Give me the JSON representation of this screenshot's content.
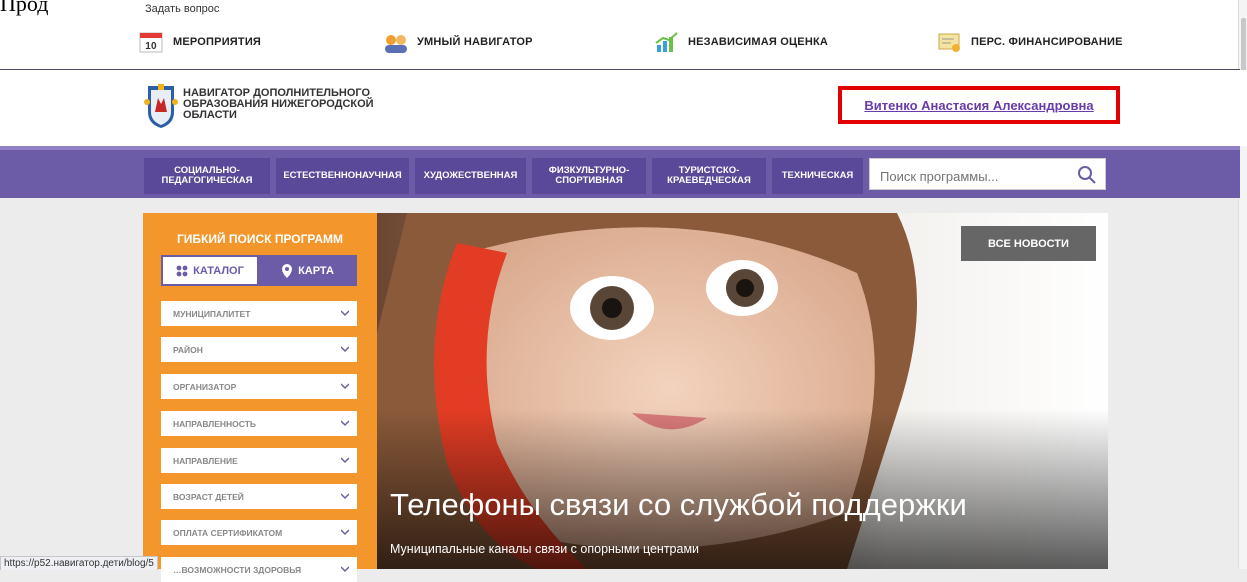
{
  "top": {
    "doc_fragment": "Прод",
    "ask_question": "Задать вопрос",
    "links": [
      {
        "label": "МЕРОПРИЯТИЯ",
        "icon": "calendar-icon",
        "badge": "10"
      },
      {
        "label": "УМНЫЙ НАВИГАТОР",
        "icon": "people-icon"
      },
      {
        "label": "НЕЗАВИСИМАЯ ОЦЕНКА",
        "icon": "chart-icon"
      },
      {
        "label": "ПЕРС. ФИНАНСИРОВАНИЕ",
        "icon": "certificate-icon"
      }
    ]
  },
  "header": {
    "brand": "НАВИГАТОР ДОПОЛНИТЕЛЬНОГО ОБРАЗОВАНИЯ НИЖЕГОРОДСКОЙ ОБЛАСТИ",
    "user": "Витенко Анастасия Александровна"
  },
  "categories": [
    "СОЦИАЛЬНО-ПЕДАГОГИЧЕСКАЯ",
    "ЕСТЕСТВЕННОНАУЧНАЯ",
    "ХУДОЖЕСТВЕННАЯ",
    "ФИЗКУЛЬТУРНО-СПОРТИВНАЯ",
    "ТУРИСТСКО-КРАЕВЕДЧЕСКАЯ",
    "ТЕХНИЧЕСКАЯ"
  ],
  "search": {
    "placeholder": "Поиск программы..."
  },
  "filter": {
    "title": "ГИБКИЙ ПОИСК ПРОГРАММ",
    "tab_catalog": "КАТАЛОГ",
    "tab_map": "КАРТА",
    "selects": [
      "МУНИЦИПАЛИТЕТ",
      "РАЙОН",
      "ОРГАНИЗАТОР",
      "НАПРАВЛЕННОСТЬ",
      "НАПРАВЛЕНИЕ",
      "ВОЗРАСТ ДЕТЕЙ",
      "ОПЛАТА СЕРТИФИКАТОМ",
      "…ВОЗМОЖНОСТИ ЗДОРОВЬЯ"
    ]
  },
  "hero": {
    "all_news": "ВСЕ НОВОСТИ",
    "title": "Телефоны связи со службой поддержки",
    "subtitle": "Муниципальные каналы связи с опорными центрами"
  },
  "status_url": "https://p52.навигатор.дети/blog/5",
  "colors": {
    "accent": "#6c5ba7",
    "orange": "#f3962b",
    "highlight": "#e30000"
  }
}
